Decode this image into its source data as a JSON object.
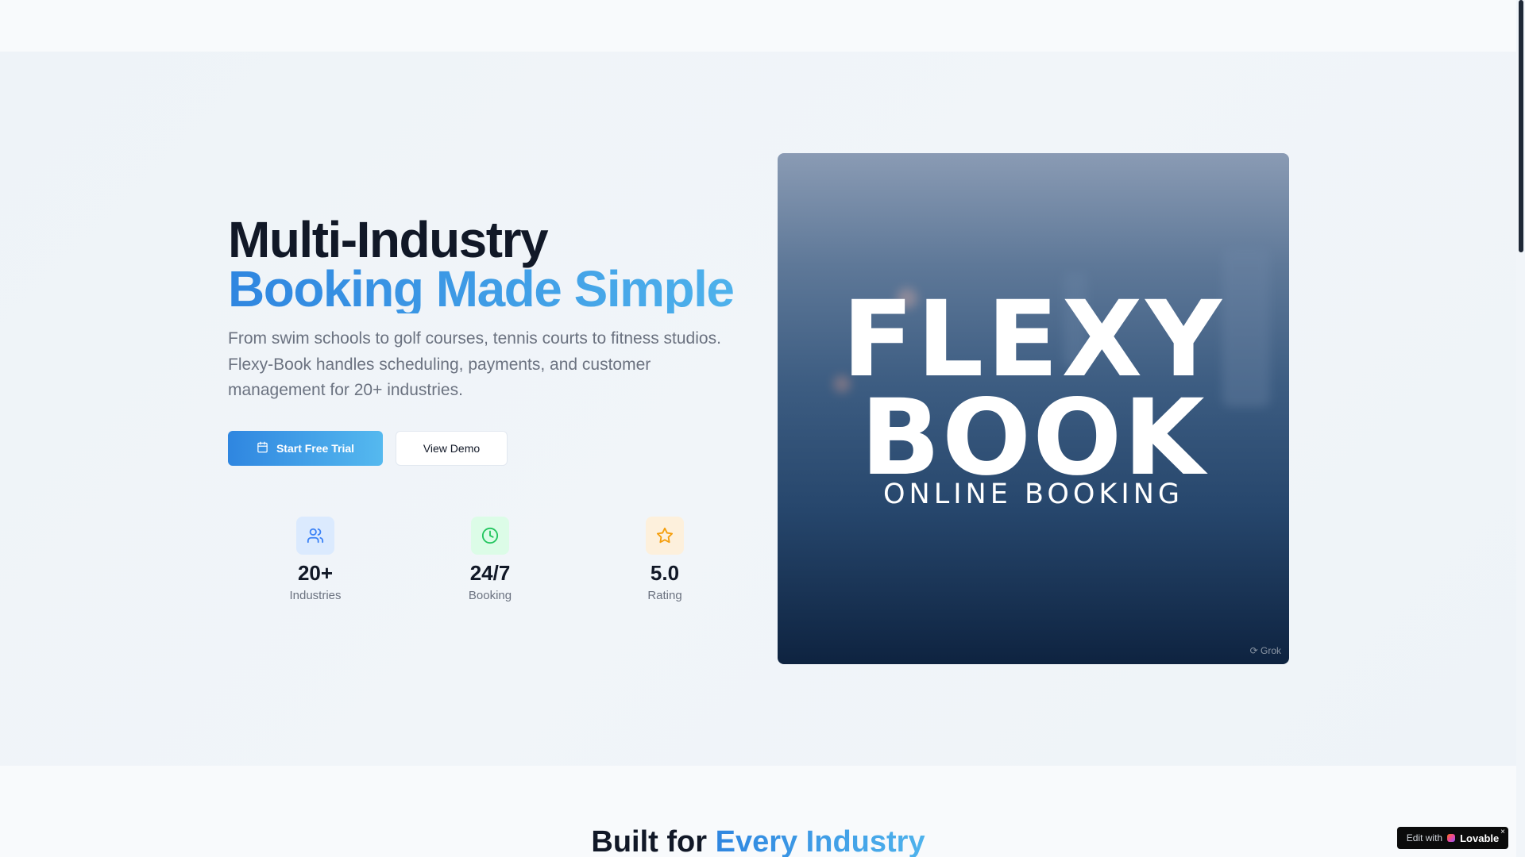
{
  "hero": {
    "headline_line1": "Multi-Industry",
    "headline_line2": "Booking Made Simple",
    "subtitle": "From swim schools to golf courses, tennis courts to fitness studios. Flexy-Book handles scheduling, payments, and customer management for 20+ industries.",
    "primary_cta": {
      "label": "Start Free Trial",
      "icon": "calendar-icon"
    },
    "secondary_cta": {
      "label": "View Demo"
    },
    "stats": [
      {
        "value": "20+",
        "label": "Industries",
        "icon": "users-icon",
        "icon_bg": "#dbeafe",
        "icon_color": "#3b82f6"
      },
      {
        "value": "24/7",
        "label": "Booking",
        "icon": "clock-icon",
        "icon_bg": "#dcfce7",
        "icon_color": "#22c55e"
      },
      {
        "value": "5.0",
        "label": "Rating",
        "icon": "star-icon",
        "icon_bg": "#fef3c7",
        "icon_color": "#f59e0b"
      }
    ],
    "image": {
      "logo_line1": "FLEXY",
      "logo_line2": "BOOK",
      "logo_tagline": "ONLINE BOOKING",
      "watermark": "Grok"
    }
  },
  "section": {
    "title_prefix": "Built for",
    "title_accent": "Every Industry"
  },
  "badge": {
    "edit_label": "Edit with",
    "brand": "Lovable",
    "close": "×"
  },
  "colors": {
    "accent": "#2f86e0",
    "accent_light": "#4fb3ec",
    "text_primary": "#111827",
    "text_muted": "#6b7280"
  }
}
